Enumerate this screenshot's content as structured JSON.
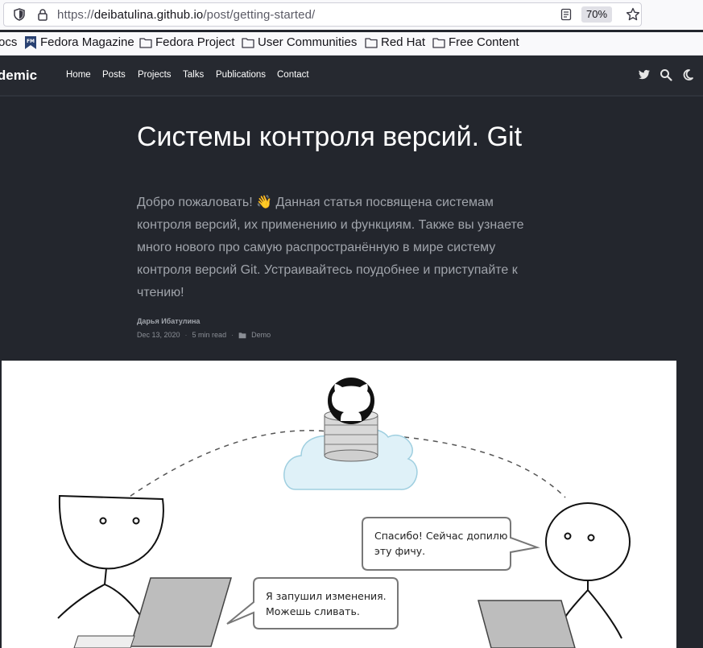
{
  "browser": {
    "url_prefix": "https://",
    "url_host": "deibatulina.github.io",
    "url_path": "/post/getting-started/",
    "zoom": "70%"
  },
  "bookmarks": [
    "ocs",
    "Fedora Magazine",
    "Fedora Project",
    "User Communities",
    "Red Hat",
    "Free Content"
  ],
  "navbar": {
    "brand": "cademic",
    "links": [
      "Home",
      "Posts",
      "Projects",
      "Talks",
      "Publications",
      "Contact"
    ]
  },
  "article": {
    "title": "Системы контроля версий. Git",
    "summary": "Добро пожаловать! 👋 Данная статья посвящена системам контроля версий, их применению и функциям. Также вы узнаете много нового про самую распространённую в мире систему контроля версий Git. Устраивайтесь поудобнее и приступайте к чтению!",
    "author": "Дарья Ибатулина",
    "date": "Dec 13, 2020",
    "read_time": "5 min read",
    "category": "Demo"
  },
  "illustration": {
    "bubble_right": [
      "Спасибо! Сейчас допилю",
      "эту фичу."
    ],
    "bubble_left": [
      "Я запушил изменения.",
      "Можешь сливать."
    ]
  }
}
